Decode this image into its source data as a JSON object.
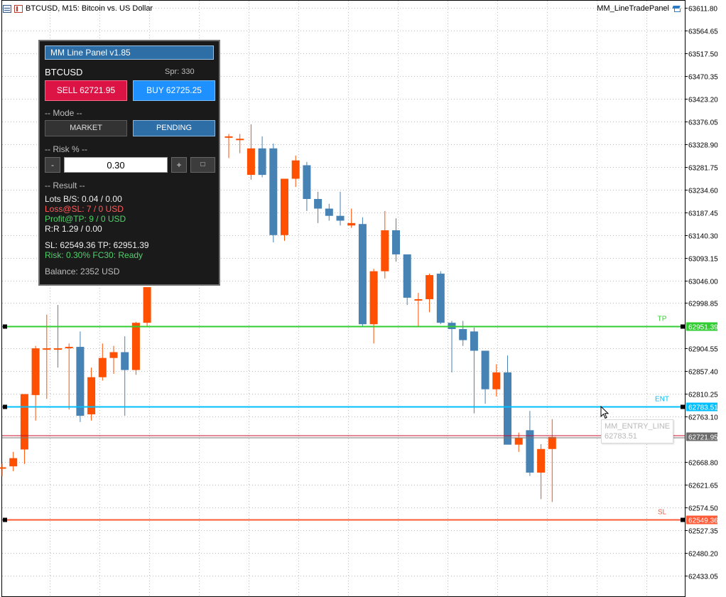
{
  "chart": {
    "title": "BTCUSD, M15:  Bitcoin vs. US Dollar",
    "ea_name": "MM_LineTradePanel",
    "icons": [
      "chart-menu-icon",
      "chart-type-icon",
      "ea-cap-icon",
      "mouse-cursor-icon"
    ],
    "price_axis": [
      "63611.80",
      "63564.65",
      "63517.50",
      "63470.35",
      "63423.20",
      "63376.05",
      "63328.90",
      "63281.75",
      "63234.60",
      "63187.45",
      "63140.30",
      "63093.15",
      "63046.00",
      "62998.85",
      "62904.55",
      "62857.40",
      "62810.25",
      "62763.10",
      "62668.80",
      "62621.65",
      "62574.50",
      "62527.35",
      "62480.20",
      "62433.05"
    ],
    "price_ticks": [
      63611.8,
      63564.65,
      63517.5,
      63470.35,
      63423.2,
      63376.05,
      63328.9,
      63281.75,
      63234.6,
      63187.45,
      63140.3,
      63093.15,
      63046.0,
      62998.85,
      62904.55,
      62857.4,
      62810.25,
      62763.1,
      62668.8,
      62621.65,
      62574.5,
      62527.35,
      62480.2,
      62433.05
    ],
    "colors": {
      "bull": "#ff4f00",
      "bear": "#4682b4",
      "tp": "#32cd32",
      "entry": "#00bfff",
      "sl": "#ff5a37",
      "bid": "#c8102e",
      "grid": "#c0c0c0"
    },
    "candles": [
      [
        62658,
        62666,
        62640,
        62658
      ],
      [
        62660,
        62690,
        62650,
        62677
      ],
      [
        62695,
        62810,
        62665,
        62810
      ],
      [
        62808,
        62910,
        62755,
        62905
      ],
      [
        62905,
        62975,
        62800,
        62905
      ],
      [
        62905,
        62995,
        62865,
        62905
      ],
      [
        62908,
        62915,
        62778,
        62908
      ],
      [
        62908,
        62940,
        62752,
        62765
      ],
      [
        62768,
        62865,
        62755,
        62845
      ],
      [
        62845,
        62915,
        62838,
        62885
      ],
      [
        62885,
        62910,
        62852,
        62897
      ],
      [
        62897,
        62930,
        62765,
        62860
      ],
      [
        62860,
        62960,
        62850,
        62958
      ],
      [
        62958,
        63020,
        62950,
        63032
      ]
    ],
    "candles2": [
      [
        63345,
        63350,
        63300,
        63345
      ],
      [
        63340,
        63350,
        63310,
        63340
      ],
      [
        63265,
        63370,
        63255,
        63320
      ],
      [
        63320,
        63345,
        63260,
        63265
      ],
      [
        63320,
        63330,
        63125,
        63140
      ],
      [
        63140,
        63250,
        63128,
        63257
      ],
      [
        63257,
        63305,
        63240,
        63295
      ],
      [
        63285,
        63292,
        63190,
        63215
      ],
      [
        63215,
        63230,
        63165,
        63195
      ],
      [
        63195,
        63205,
        63170,
        63180
      ],
      [
        63180,
        63230,
        63160,
        63170
      ],
      [
        63160,
        63195,
        63155,
        63165
      ],
      [
        63163,
        63177,
        62950,
        62955
      ],
      [
        62955,
        63070,
        62915,
        63065
      ],
      [
        63065,
        63190,
        63050,
        63150
      ],
      [
        63150,
        63175,
        63085,
        63100
      ],
      [
        63100,
        63100,
        62995,
        63010
      ],
      [
        63007,
        63020,
        62950,
        63007
      ],
      [
        63007,
        63060,
        62980,
        63057
      ],
      [
        63060,
        63065,
        62955,
        62958
      ],
      [
        62958,
        62962,
        62855,
        62945
      ],
      [
        62945,
        62962,
        62910,
        62922
      ],
      [
        62940,
        62948,
        62770,
        62900
      ],
      [
        62900,
        62900,
        62790,
        62820
      ],
      [
        62820,
        62872,
        62805,
        62855
      ],
      [
        62855,
        62890,
        62705,
        62705
      ],
      [
        62705,
        62730,
        62690,
        62720
      ],
      [
        62735,
        62775,
        62640,
        62647
      ],
      [
        62647,
        62706,
        62592,
        62696
      ],
      [
        62696,
        62758,
        62586,
        62721
      ]
    ],
    "candle_x_step": 15.7,
    "tp": {
      "label": "TP",
      "price_text": "62951.39",
      "price": 62951.39
    },
    "entry": {
      "label": "ENT",
      "price_text": "62783.51",
      "price": 62783.51
    },
    "bid": {
      "price_text": "62721.95",
      "price": 62721.95
    },
    "sl": {
      "label": "SL",
      "price_text": "62549.36",
      "price": 62549.36
    }
  },
  "tooltip": {
    "name": "MM_ENTRY_LINE",
    "price": "62783.51"
  },
  "panel": {
    "title": "MM Line Panel  v1.85",
    "symbol": "BTCUSD",
    "spread": "Spr: 330",
    "sell_label": "SELL  62721.95",
    "buy_label": "BUY  62725.25",
    "mode_header": "-- Mode --",
    "market_label": "MARKET",
    "pending_label": "PENDING",
    "risk_header": "-- Risk % --",
    "minus_label": "-",
    "risk_value": "0.30",
    "plus_label": "+",
    "square_label": "□",
    "result_header": "-- Result --",
    "lots": "Lots B/S: 0.04 / 0.00",
    "loss": "Loss@SL: 7 / 0 USD",
    "profit": "Profit@TP: 9 / 0 USD",
    "rr": "R:R  1.29 / 0.00",
    "sl_tp": "SL: 62549.36   TP: 62951.39",
    "risk_status": "Risk: 0.30%   FC30: Ready",
    "balance": "Balance: 2352 USD"
  }
}
